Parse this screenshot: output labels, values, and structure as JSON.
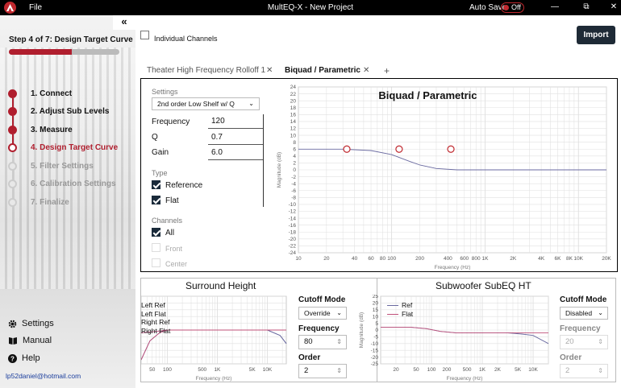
{
  "app": {
    "file_menu": "File",
    "title": "MultEQ-X - New Project",
    "auto_save_label": "Auto Save",
    "auto_save_state": "Off",
    "window_controls": [
      "—",
      "⧉",
      "✕"
    ]
  },
  "sidebar": {
    "collapse_glyph": "«",
    "step_title": "Step 4 of 7: Design Target Curve",
    "progress_fraction": 0.57,
    "steps": [
      {
        "label": "1.  Connect",
        "state": "done"
      },
      {
        "label": "2.  Adjust Sub Levels",
        "state": "done"
      },
      {
        "label": "3.  Measure",
        "state": "done"
      },
      {
        "label": "4.  Design Target Curve",
        "state": "current"
      },
      {
        "label": "5.  Filter Settings",
        "state": "future"
      },
      {
        "label": "6.  Calibration Settings",
        "state": "future"
      },
      {
        "label": "7.  Finalize",
        "state": "future"
      }
    ],
    "settings_label": "Settings",
    "manual_label": "Manual",
    "help_label": "Help",
    "email": "lp52daniel@hotmail.com"
  },
  "main": {
    "individual_channels_label": "Individual Channels",
    "import_label": "Import",
    "tabs": [
      {
        "label": "Theater High Frequency Rolloff 1",
        "active": false
      },
      {
        "label": "Biquad / Parametric",
        "active": true
      }
    ],
    "tab_add": "+",
    "tab_close": "✕",
    "panel": {
      "settings_label": "Settings",
      "filter_type": "2nd order Low Shelf w/ Q",
      "frequency_label": "Frequency",
      "frequency_value": "120",
      "q_label": "Q",
      "q_value": "0.7",
      "gain_label": "Gain",
      "gain_value": "6.0",
      "type_label": "Type",
      "type_reference": "Reference",
      "type_flat": "Flat",
      "channels_label": "Channels",
      "channel_all": "All",
      "channel_front": "Front",
      "channel_center": "Center"
    },
    "surround": {
      "title": "Surround Height",
      "legend": [
        "Left Ref",
        "Left Flat",
        "Right Ref",
        "Right Flat"
      ],
      "cutoff_label": "Cutoff Mode",
      "cutoff_value": "Override",
      "frequency_label": "Frequency",
      "frequency_value": "80",
      "order_label": "Order",
      "order_value": "2"
    },
    "subwoofer": {
      "title": "Subwoofer SubEQ HT",
      "legend": [
        "Ref",
        "Flat"
      ],
      "cutoff_label": "Cutoff Mode",
      "cutoff_value": "Disabled",
      "frequency_label": "Frequency",
      "frequency_value": "20",
      "order_label": "Order",
      "order_value": "2"
    }
  },
  "chart_data": [
    {
      "type": "line",
      "title": "Biquad / Parametric",
      "xlabel": "Frequency (Hz)",
      "ylabel": "Magnitude (dB)",
      "x_scale": "log",
      "xlim": [
        10,
        20000
      ],
      "ylim": [
        -24,
        24
      ],
      "x_ticks": [
        "10",
        "20",
        "40",
        "60",
        "80",
        "100",
        "200",
        "400",
        "600",
        "800",
        "1K",
        "2K",
        "4K",
        "6K",
        "8K",
        "10K",
        "20K"
      ],
      "y_ticks": [
        24,
        22,
        20,
        18,
        16,
        14,
        12,
        10,
        8,
        6,
        4,
        2,
        0,
        -2,
        -4,
        -6,
        -8,
        -10,
        -12,
        -14,
        -16,
        -18,
        -20,
        -22,
        -24
      ],
      "grid": true,
      "series": [
        {
          "x": [
            10,
            30,
            60,
            100,
            150,
            200,
            300,
            500,
            1000,
            20000
          ],
          "y": [
            6,
            6,
            5.6,
            4.4,
            2.6,
            1.4,
            0.4,
            0,
            0,
            0
          ]
        }
      ],
      "control_points": [
        {
          "x": 33,
          "y": 6
        },
        {
          "x": 120,
          "y": 6
        },
        {
          "x": 430,
          "y": 6
        }
      ],
      "colors": {
        "curve": "#6a6aa0",
        "points": "#c0282e"
      }
    },
    {
      "type": "line",
      "title": "Surround Height",
      "xlabel": "Frequency (Hz)",
      "x_scale": "log",
      "xlim": [
        30,
        24000
      ],
      "ylim": [
        -25,
        25
      ],
      "x_ticks": [
        "50",
        "100",
        "500",
        "1K",
        "5K",
        "10K"
      ],
      "series": [
        {
          "name": "Left Ref",
          "x": [
            30,
            60,
            100,
            150,
            300,
            1000,
            3000,
            10000,
            18000,
            24000
          ],
          "y": [
            -2,
            -1,
            0,
            0,
            0,
            0,
            0,
            0,
            -4,
            -10
          ]
        },
        {
          "name": "Left Flat",
          "x": [
            30,
            60,
            100,
            150,
            300,
            1000,
            3000,
            10000,
            24000
          ],
          "y": [
            -2,
            -1,
            0,
            0,
            0,
            0,
            0,
            0,
            0
          ]
        },
        {
          "name": "Right Ref",
          "x": [
            30,
            45,
            70,
            100,
            150,
            300,
            1000,
            3000,
            10000,
            18000,
            24000
          ],
          "y": [
            -22,
            -8,
            -2,
            0,
            0,
            0,
            0,
            0,
            0,
            -4,
            -10
          ]
        },
        {
          "name": "Right Flat",
          "x": [
            30,
            45,
            70,
            100,
            150,
            300,
            1000,
            3000,
            10000,
            24000
          ],
          "y": [
            -22,
            -8,
            -2,
            0,
            0,
            0,
            0,
            0,
            0,
            0
          ]
        }
      ],
      "colors": {
        "ref": "#6a6aa0",
        "flat": "#c0507a"
      }
    },
    {
      "type": "line",
      "title": "Subwoofer SubEQ HT",
      "xlabel": "Frequency (Hz)",
      "ylabel": "Magnitude (dB)",
      "x_scale": "log",
      "xlim": [
        10,
        20000
      ],
      "ylim": [
        -25,
        25
      ],
      "y_ticks": [
        25,
        20,
        15,
        10,
        5,
        0,
        -5,
        -10,
        -15,
        -20,
        -25
      ],
      "x_ticks": [
        "20",
        "50",
        "100",
        "200",
        "500",
        "1K",
        "2K",
        "5K",
        "10K"
      ],
      "series": [
        {
          "name": "Ref",
          "x": [
            10,
            40,
            80,
            150,
            300,
            1000,
            3000,
            6000,
            10000,
            20000
          ],
          "y": [
            2,
            2,
            1,
            -1,
            -2,
            -2,
            -2,
            -3,
            -4,
            -10
          ]
        },
        {
          "name": "Flat",
          "x": [
            10,
            40,
            80,
            150,
            300,
            1000,
            20000
          ],
          "y": [
            2,
            2,
            1,
            -1,
            -2,
            -2,
            -2
          ]
        }
      ],
      "colors": {
        "ref": "#6a6aa0",
        "flat": "#c0507a"
      }
    }
  ]
}
